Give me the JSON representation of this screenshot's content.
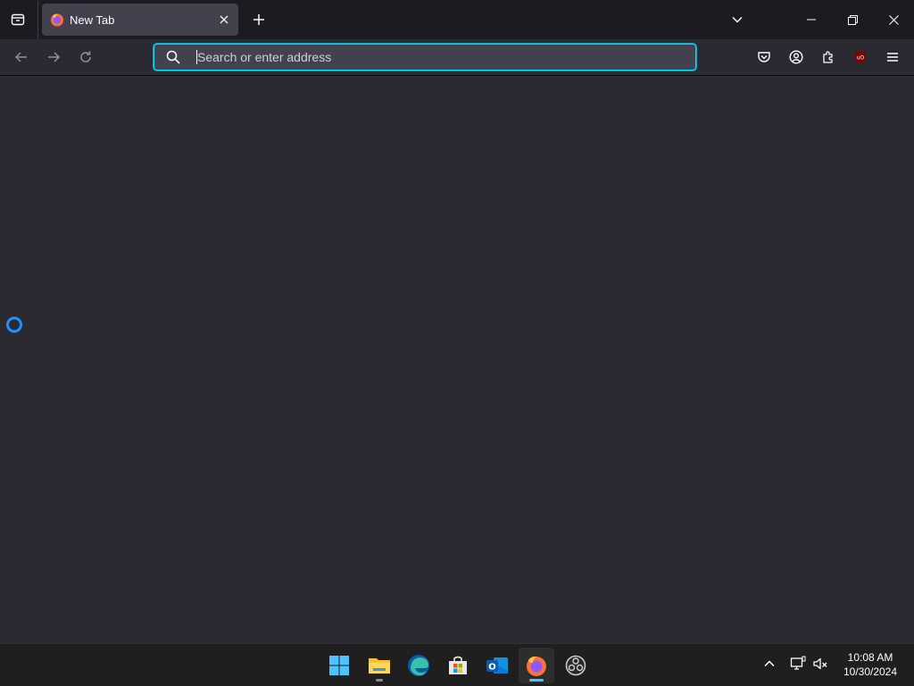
{
  "browser": {
    "tab": {
      "title": "New Tab"
    },
    "urlbar": {
      "placeholder": "Search or enter address",
      "value": ""
    }
  },
  "taskbar": {
    "apps": [
      "start-icon",
      "file-explorer-icon",
      "edge-icon",
      "microsoft-store-icon",
      "outlook-icon",
      "firefox-icon",
      "obs-studio-icon"
    ],
    "clock": {
      "time": "10:08 AM",
      "date": "10/30/2024"
    }
  },
  "colors": {
    "accent": "#00ddff",
    "spinner": "#1e90ff",
    "taskbar_active": "#4cc2ff",
    "ublock": "#800000"
  }
}
